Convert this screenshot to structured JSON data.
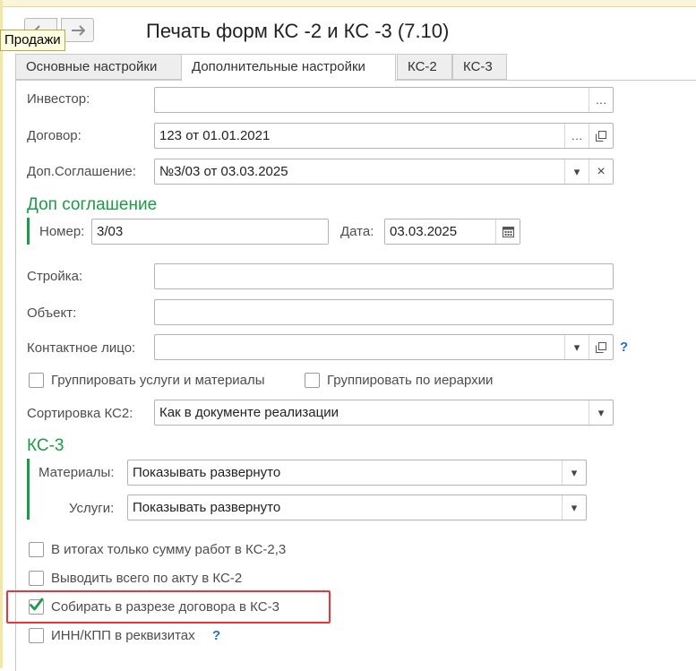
{
  "window": {
    "title": "Печать форм КС -2 и КС -3 (7.10)",
    "tooltip": "Продажи"
  },
  "tabs": [
    {
      "label": "Основные настройки",
      "active": false
    },
    {
      "label": "Дополнительные настройки",
      "active": true
    },
    {
      "label": "КС-2",
      "active": false
    },
    {
      "label": "КС-3",
      "active": false
    }
  ],
  "fields": {
    "investor": {
      "label": "Инвестор:",
      "value": ""
    },
    "contract": {
      "label": "Договор:",
      "value": "123 от 01.01.2021"
    },
    "agreement": {
      "label": "Доп.Соглашение:",
      "value": "№3/03 от 03.03.2025"
    },
    "construction": {
      "label": "Стройка:",
      "value": ""
    },
    "object": {
      "label": "Объект:",
      "value": ""
    },
    "contact": {
      "label": "Контактное лицо:",
      "value": ""
    },
    "sort_ks2": {
      "label": "Сортировка КС2:",
      "value": "Как в документе реализации"
    }
  },
  "agreement_section": {
    "title": "Доп соглашение",
    "number_label": "Номер:",
    "number_value": "3/03",
    "date_label": "Дата:",
    "date_value": "03.03.2025"
  },
  "grouping": {
    "services_materials": {
      "label": "Группировать услуги и материалы",
      "checked": false
    },
    "hierarchy": {
      "label": "Группировать по иерархии",
      "checked": false
    }
  },
  "ks3_section": {
    "title": "КС-3",
    "materials_label": "Материалы:",
    "materials_value": "Показывать развернуто",
    "services_label": "Услуги:",
    "services_value": "Показывать развернуто"
  },
  "options": [
    {
      "label": "В итогах только сумму работ в КС-2,3",
      "checked": false
    },
    {
      "label": "Выводить всего по акту в КС-2",
      "checked": false
    },
    {
      "label": "Собирать в разрезе договора в КС-3",
      "checked": true
    },
    {
      "label": "ИНН/КПП в реквизитах",
      "checked": false
    }
  ],
  "icons": {
    "more": "…",
    "open": "open-icon",
    "dropdown": "▾",
    "clear": "×",
    "help": "?"
  },
  "colors": {
    "accent_green": "#1d9a47",
    "highlight_red": "#e8373a",
    "help_blue": "#1a74c9"
  }
}
